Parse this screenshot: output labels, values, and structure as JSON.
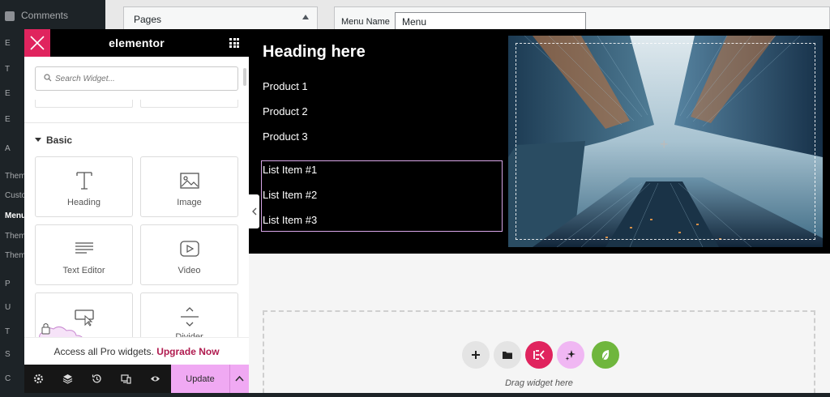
{
  "wp_admin": {
    "top_item": "Comments",
    "pages_box": "Pages",
    "menu_name_label": "Menu Name",
    "menu_name_value": "Menu",
    "side_items": [
      "E",
      "T",
      "E",
      "E",
      "A",
      "Them",
      "Custo",
      "Menu",
      "Them",
      "Them",
      "P",
      "U",
      "T",
      "S",
      "C"
    ]
  },
  "panel": {
    "brand": "elementor",
    "search_placeholder": "Search Widget...",
    "category": "Basic",
    "widgets": [
      {
        "label": "Heading",
        "icon": "heading-icon"
      },
      {
        "label": "Image",
        "icon": "image-icon"
      },
      {
        "label": "Text Editor",
        "icon": "text-editor-icon"
      },
      {
        "label": "Video",
        "icon": "video-icon"
      },
      {
        "label": "",
        "icon": "button-icon"
      },
      {
        "label": "Divider",
        "icon": "divider-icon"
      }
    ],
    "pro_text": "Access all Pro widgets.",
    "pro_link": "Upgrade Now",
    "update_label": "Update"
  },
  "canvas": {
    "heading": "Heading here",
    "products": [
      "Product 1",
      "Product 2",
      "Product 3"
    ],
    "list_items": [
      "List Item #1",
      "List Item #2",
      "List Item #3"
    ],
    "drop_text": "Drag widget here"
  },
  "colors": {
    "accent_pink": "#e0245e",
    "update_pink": "#f0a9f3",
    "upgrade_link": "#b01b4f",
    "ai_button": "#f0b7f3",
    "green_button": "#6fb63d"
  }
}
